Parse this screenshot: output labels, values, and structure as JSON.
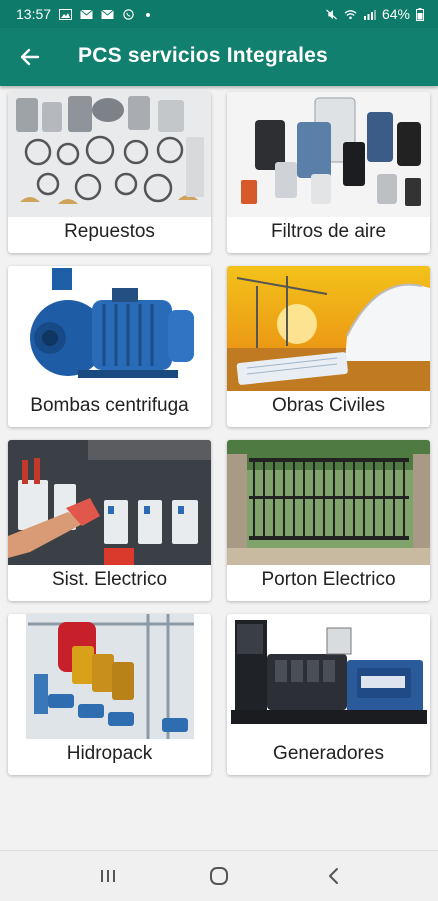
{
  "status": {
    "time": "13:57",
    "battery": "64%"
  },
  "appbar": {
    "title": "PCS servicios Integrales"
  },
  "items": [
    {
      "label": "Repuestos"
    },
    {
      "label": "Filtros de aire"
    },
    {
      "label": "Bombas centrifuga"
    },
    {
      "label": "Obras Civiles"
    },
    {
      "label": "Sist. Electrico"
    },
    {
      "label": "Porton Electrico"
    },
    {
      "label": "Hidropack"
    },
    {
      "label": "Generadores"
    }
  ],
  "colors": {
    "primary": "#12806f",
    "status_bar": "#0e7a6a"
  },
  "icons": {
    "back": "arrow-left-icon",
    "nav": [
      "recent-apps-icon",
      "home-icon",
      "back-icon"
    ]
  }
}
